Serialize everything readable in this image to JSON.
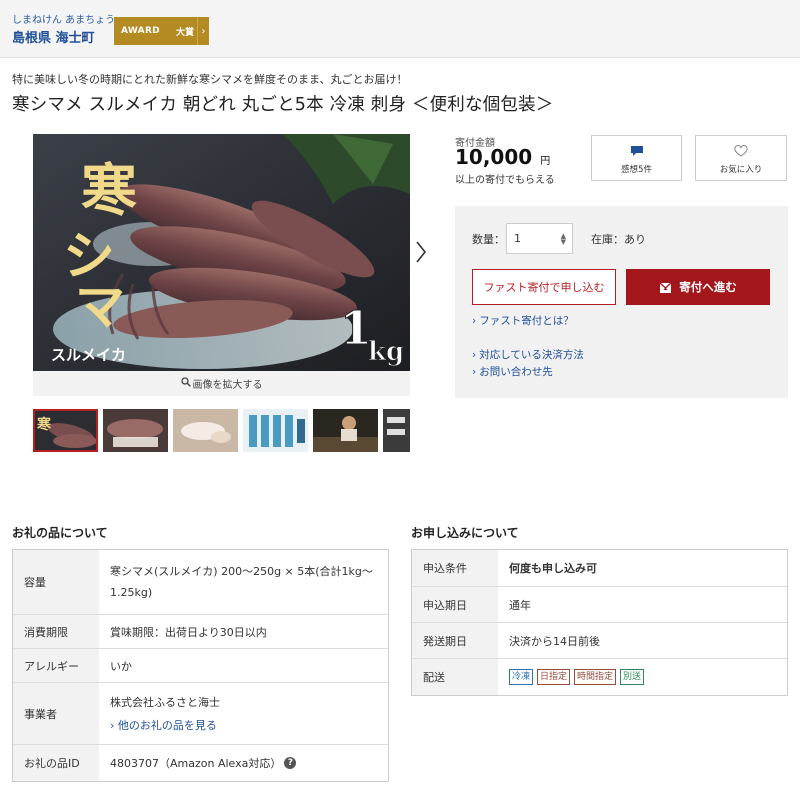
{
  "header": {
    "municipality_kana": "しまねけん あまちょう",
    "municipality_name": "島根県 海士町",
    "award": {
      "label": "AWARD",
      "rank": "大賞"
    }
  },
  "product": {
    "subtitle": "特に美味しい冬の時期にとれた新鮮な寒シマメを鮮度そのまま、丸ごとお届け！",
    "title": "寒シマメ スルメイカ 朝どれ 丸ごと5本 冷凍 刺身 ＜便利な個包装＞",
    "image_text": {
      "main": "寒シマメ",
      "sub": "スルメイカ",
      "weight_num": "1",
      "weight_unit": "kg"
    },
    "zoom_label": "画像を拡大する",
    "thumbnail_count": 6,
    "selected_thumbnail": 1
  },
  "purchase": {
    "price_label": "寄付金額",
    "price": "10,000",
    "currency": "円",
    "price_note": "以上の寄付でもらえる",
    "reviews_label": "感想5件",
    "favorite_label": "お気に入り",
    "qty_label": "数量：",
    "qty_value": "1",
    "stock": "在庫：あり",
    "fast_button": "ファスト寄付で申し込む",
    "donate_button": "寄付へ進む",
    "links": [
      "ファスト寄付とは？",
      "対応している決済方法",
      "お問い合わせ先"
    ]
  },
  "gift_info": {
    "heading": "お礼の品について",
    "capacity_label": "容量",
    "capacity_value": "寒シマメ(スルメイカ) 200～250g × 5本(合計1kg～1.25kg)",
    "expiry_label": "消費期限",
    "expiry_value": "賞味期限：出荷日より30日以内",
    "allergy_label": "アレルギー",
    "allergy_value": "いか",
    "business_label": "事業者",
    "business_value": "株式会社ふるさと海士",
    "business_link": "他のお礼の品を見る",
    "id_label": "お礼の品ID",
    "id_value": "4803707（Amazon Alexa対応）"
  },
  "application_info": {
    "heading": "お申し込みについて",
    "condition_label": "申込条件",
    "condition_value": "何度も申し込み可",
    "period_label": "申込期日",
    "period_value": "通年",
    "shipping_label": "発送期日",
    "shipping_value": "決済から14日前後",
    "delivery_label": "配送",
    "delivery_tags": [
      {
        "label": "冷凍",
        "color": "#2a73b8"
      },
      {
        "label": "日指定",
        "color": "#9a4a3c"
      },
      {
        "label": "時間指定",
        "color": "#9a4a3c"
      },
      {
        "label": "別送",
        "color": "#2e8a57"
      }
    ]
  },
  "colors": {
    "accent_red": "#a3171c",
    "link_blue": "#1f4f99",
    "award_gold": "#b48a22"
  }
}
